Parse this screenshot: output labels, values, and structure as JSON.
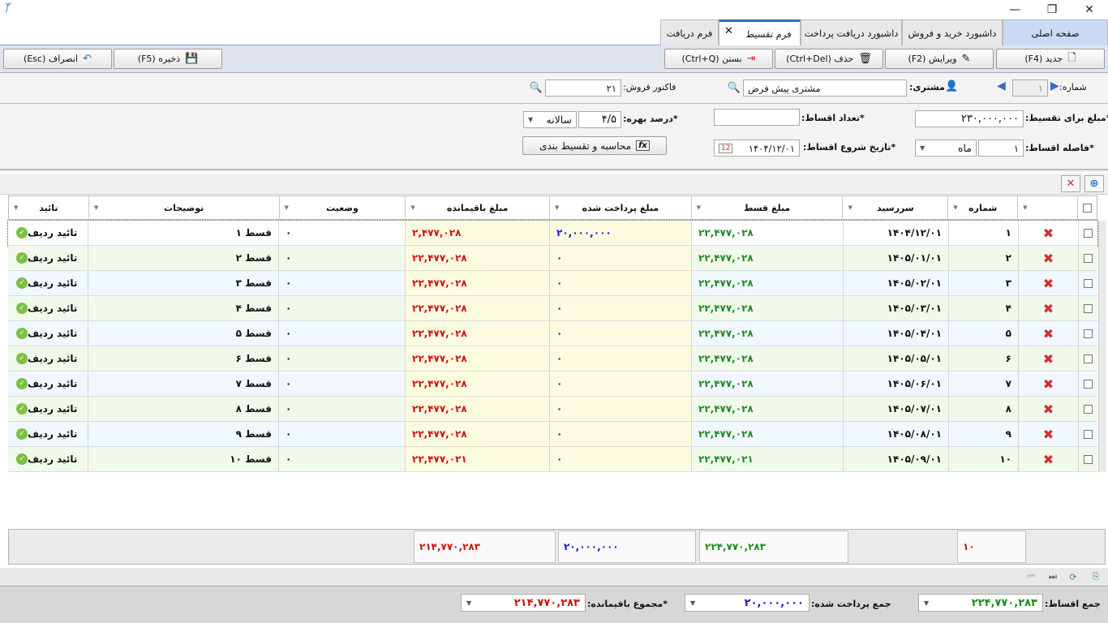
{
  "window": {
    "minimize": "—",
    "restore": "❐",
    "close": "✕"
  },
  "tabs": {
    "home": "صفحه اصلی",
    "buysell": "داشبورد خرید و فروش",
    "payments": "داشبورد دریافت پرداخت",
    "installment": "فرم تقسیط",
    "receive": "فرم دریافت",
    "close_x": "✕"
  },
  "toolbar": {
    "new": "جدید (F4)",
    "edit": "ویرایش (F2)",
    "delete": "حذف (Ctrl+Del)",
    "close": "بستن (Ctrl+Q)",
    "save": "ذخیره (F5)",
    "cancel": "انصراف (Esc)"
  },
  "header": {
    "number_label": "شماره:",
    "number_value": "۱",
    "customer_label": "مشتری:",
    "customer_value": "مشتری پیش فرض",
    "invoice_label": "فاکتور فروش:",
    "invoice_value": "۲۱"
  },
  "form": {
    "amount_label": "*مبلغ برای تقسیط:",
    "amount_value": "۲۳۰,۰۰۰,۰۰۰",
    "count_label": "*تعداد اقساط:",
    "count_value": "",
    "rate_label": "*درصد بهره:",
    "rate_value": "۴/۵",
    "rate_period": "سالانه",
    "interval_label": "*فاصله اقساط:",
    "interval_value": "۱",
    "interval_unit": "ماه",
    "start_label": "*تاریخ شروع اقساط:",
    "start_value": "۱۴۰۴/۱۲/۰۱",
    "calc_button": "محاسبه و تقسیط بندی"
  },
  "grid": {
    "columns": [
      "شماره",
      "سررسید",
      "مبلغ قسط",
      "مبلغ پرداخت شده",
      "مبلغ باقیمانده",
      "وضعیت",
      "توضیحات",
      "تائید"
    ],
    "rows": [
      {
        "num": "۱",
        "due": "۱۴۰۴/۱۲/۰۱",
        "amount": "۲۲,۴۷۷,۰۲۸",
        "paid": "۲۰,۰۰۰,۰۰۰",
        "remain": "۲,۴۷۷,۰۲۸",
        "status": "۰",
        "desc": "قسط ۱",
        "confirm": "تائید ردیف"
      },
      {
        "num": "۲",
        "due": "۱۴۰۵/۰۱/۰۱",
        "amount": "۲۲,۴۷۷,۰۲۸",
        "paid": "۰",
        "remain": "۲۲,۴۷۷,۰۲۸",
        "status": "۰",
        "desc": "قسط ۲",
        "confirm": "تائید ردیف"
      },
      {
        "num": "۳",
        "due": "۱۴۰۵/۰۲/۰۱",
        "amount": "۲۲,۴۷۷,۰۲۸",
        "paid": "۰",
        "remain": "۲۲,۴۷۷,۰۲۸",
        "status": "۰",
        "desc": "قسط ۳",
        "confirm": "تائید ردیف"
      },
      {
        "num": "۴",
        "due": "۱۴۰۵/۰۳/۰۱",
        "amount": "۲۲,۴۷۷,۰۲۸",
        "paid": "۰",
        "remain": "۲۲,۴۷۷,۰۲۸",
        "status": "۰",
        "desc": "قسط ۴",
        "confirm": "تائید ردیف"
      },
      {
        "num": "۵",
        "due": "۱۴۰۵/۰۴/۰۱",
        "amount": "۲۲,۴۷۷,۰۲۸",
        "paid": "۰",
        "remain": "۲۲,۴۷۷,۰۲۸",
        "status": "۰",
        "desc": "قسط ۵",
        "confirm": "تائید ردیف"
      },
      {
        "num": "۶",
        "due": "۱۴۰۵/۰۵/۰۱",
        "amount": "۲۲,۴۷۷,۰۲۸",
        "paid": "۰",
        "remain": "۲۲,۴۷۷,۰۲۸",
        "status": "۰",
        "desc": "قسط ۶",
        "confirm": "تائید ردیف"
      },
      {
        "num": "۷",
        "due": "۱۴۰۵/۰۶/۰۱",
        "amount": "۲۲,۴۷۷,۰۲۸",
        "paid": "۰",
        "remain": "۲۲,۴۷۷,۰۲۸",
        "status": "۰",
        "desc": "قسط ۷",
        "confirm": "تائید ردیف"
      },
      {
        "num": "۸",
        "due": "۱۴۰۵/۰۷/۰۱",
        "amount": "۲۲,۴۷۷,۰۲۸",
        "paid": "۰",
        "remain": "۲۲,۴۷۷,۰۲۸",
        "status": "۰",
        "desc": "قسط ۸",
        "confirm": "تائید ردیف"
      },
      {
        "num": "۹",
        "due": "۱۴۰۵/۰۸/۰۱",
        "amount": "۲۲,۴۷۷,۰۲۸",
        "paid": "۰",
        "remain": "۲۲,۴۷۷,۰۲۸",
        "status": "۰",
        "desc": "قسط ۹",
        "confirm": "تائید ردیف"
      },
      {
        "num": "۱۰",
        "due": "۱۴۰۵/۰۹/۰۱",
        "amount": "۲۲,۴۷۷,۰۲۱",
        "paid": "۰",
        "remain": "۲۲,۴۷۷,۰۲۱",
        "status": "۰",
        "desc": "قسط ۱۰",
        "confirm": "تائید ردیف"
      }
    ]
  },
  "summary": {
    "count": "۱۰",
    "amount_total": "۲۲۴,۷۷۰,۲۸۳",
    "paid_total": "۲۰,۰۰۰,۰۰۰",
    "remain_total": "۲۱۴,۷۷۰,۲۸۳"
  },
  "footer": {
    "total_label": "جمع اقساط:",
    "total_value": "۲۲۴,۷۷۰,۲۸۳",
    "paid_label": "جمع پرداخت شده:",
    "paid_value": "۲۰,۰۰۰,۰۰۰",
    "remain_label": "*مجموع باقیمانده:",
    "remain_value": "۲۱۴,۷۷۰,۲۸۳"
  },
  "colors": {
    "accent": "#2f6fc2",
    "green": "#1f8a1f",
    "red": "#d01010",
    "blue": "#1616c8"
  }
}
